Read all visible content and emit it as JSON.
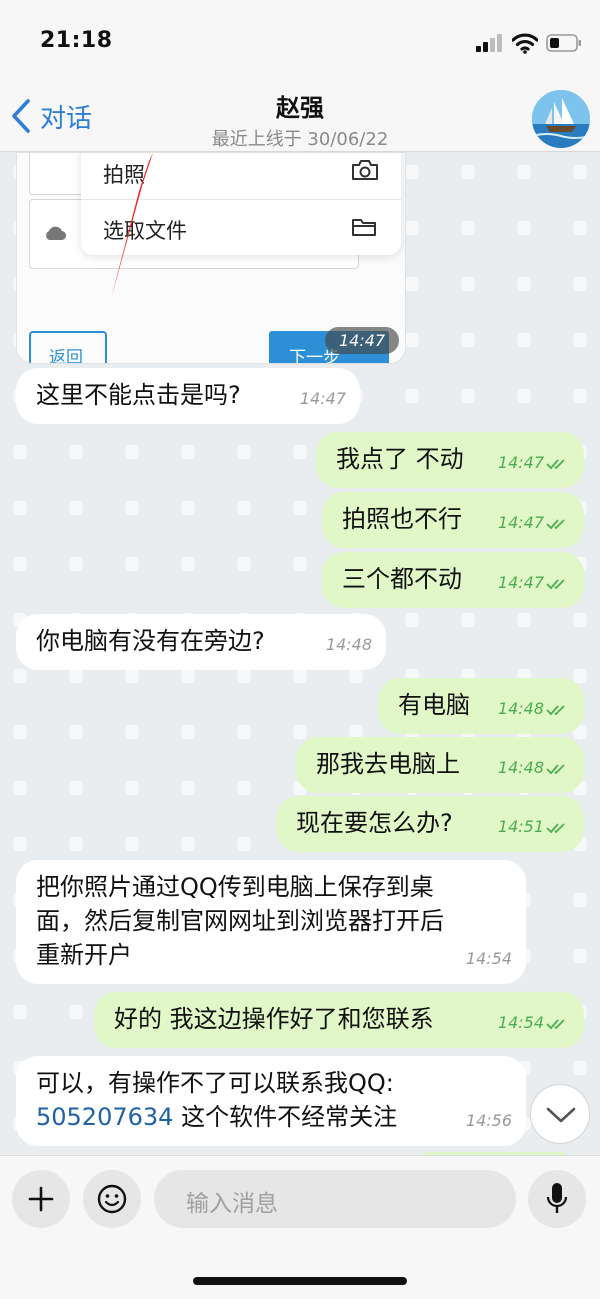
{
  "status": {
    "time": "21:18"
  },
  "header": {
    "back_label": "对话",
    "contact_name": "赵强",
    "last_seen": "最近上线于 30/06/22"
  },
  "screenshot_image": {
    "menu_items": [
      "拍照",
      "选取文件"
    ],
    "back_button": "返回",
    "next_button": "下一步",
    "timestamp": "14:47"
  },
  "messages": [
    {
      "dir": "in",
      "text": "这里不能点击是吗?",
      "time": "14:47"
    },
    {
      "dir": "out",
      "text": "我点了 不动",
      "time": "14:47"
    },
    {
      "dir": "out",
      "text": "拍照也不行",
      "time": "14:47"
    },
    {
      "dir": "out",
      "text": "三个都不动",
      "time": "14:47"
    },
    {
      "dir": "in",
      "text": "你电脑有没有在旁边?",
      "time": "14:48"
    },
    {
      "dir": "out",
      "text": "有电脑",
      "time": "14:48"
    },
    {
      "dir": "out",
      "text": "那我去电脑上",
      "time": "14:48"
    },
    {
      "dir": "out",
      "text": "现在要怎么办?",
      "time": "14:51"
    },
    {
      "dir": "in",
      "lines": [
        "把你照片通过QQ传到电脑上保存到桌",
        "面，然后复制官网网址到浏览器打开后",
        "重新开户"
      ],
      "time": "14:54"
    },
    {
      "dir": "out",
      "text": "好的 我这边操作好了和您联系",
      "time": "14:54"
    },
    {
      "dir": "in",
      "line1": "可以，有操作不了可以联系我QQ:",
      "qq": "505207634",
      "line2_rest": " 这个软件不经常关注",
      "time": "14:56"
    }
  ],
  "input": {
    "placeholder": "输入消息"
  },
  "colors": {
    "accent": "#2d7fd6",
    "outgoing_bubble": "#e1f7c8",
    "incoming_bubble": "#ffffff",
    "read_ticks": "#4cae50"
  }
}
